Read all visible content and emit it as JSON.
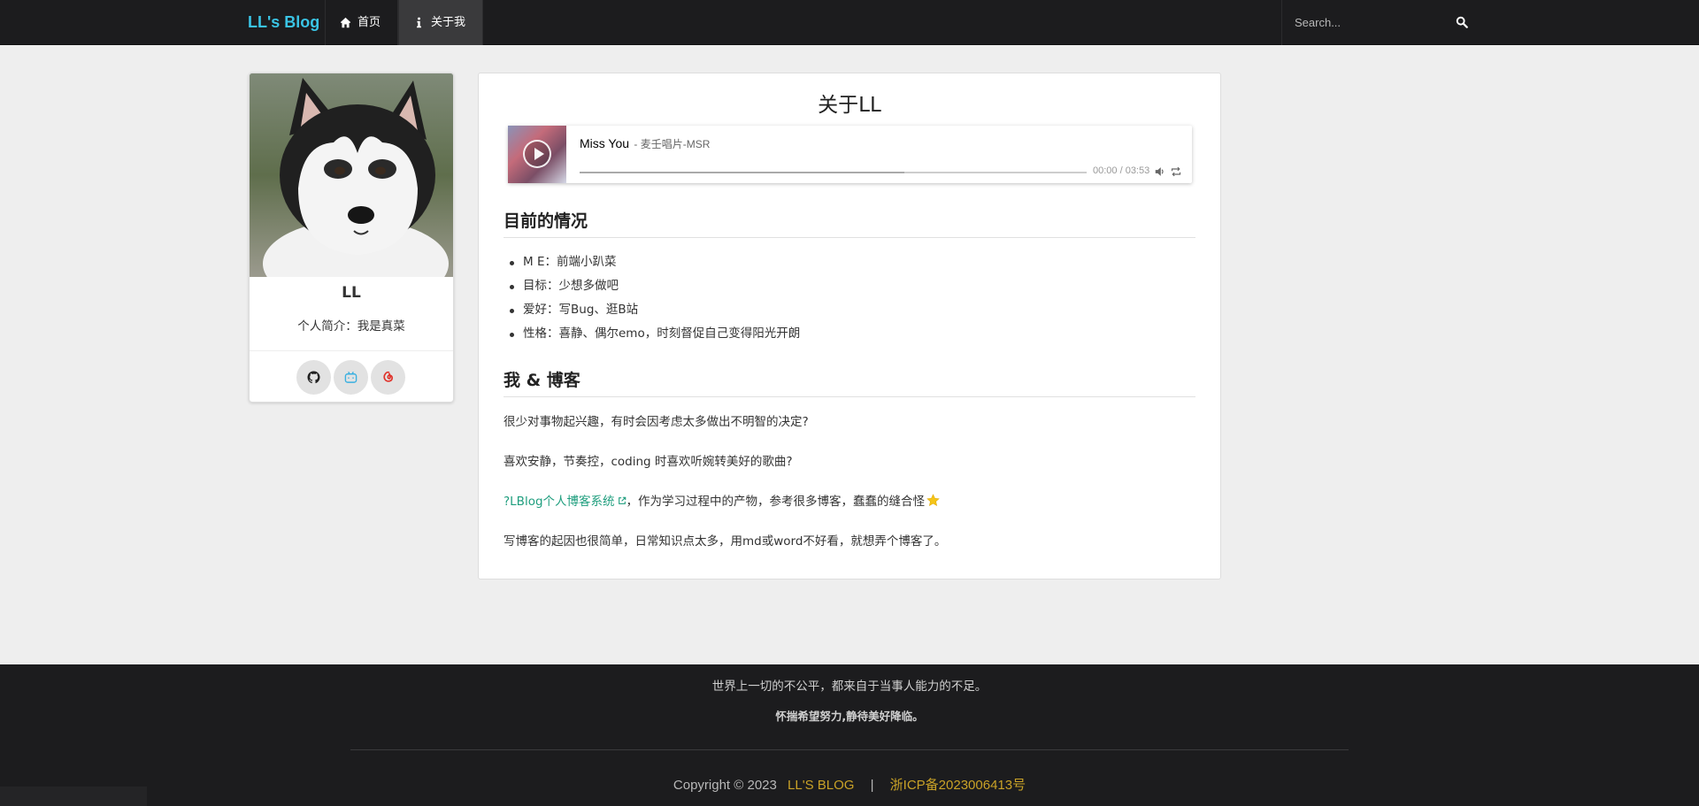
{
  "nav": {
    "brand": "LL's Blog",
    "home_label": "首页",
    "about_label": "关于我",
    "search_placeholder": "Search..."
  },
  "profile": {
    "name": "LL",
    "bio": "个人简介：我是真菜"
  },
  "article": {
    "title": "关于LL",
    "player": {
      "song": "Miss You",
      "artist": " - 麦壬唱片-MSR",
      "time": "00:00 / 03:53",
      "loaded_fraction": 0.64
    },
    "section1_title": "目前的情况",
    "status_items": [
      "M E：前端小趴菜",
      "目标：少想多做吧",
      "爱好：写Bug、逛B站",
      "性格：喜静、偶尔emo，时刻督促自己变得阳光开朗"
    ],
    "section2_title": "我 & 博客",
    "para1": "很少对事物起兴趣，有时会因考虑太多做出不明智的决定?",
    "para2": "喜欢安静，节奏控，coding 时喜欢听婉转美好的歌曲?",
    "para3_link": "?LBlog个人博客系统",
    "para3_rest": "，作为学习过程中的产物，参考很多博客，蠢蠢的缝合怪",
    "para4": "写博客的起因也很简单，日常知识点太多，用md或word不好看，就想弄个博客了。"
  },
  "footer": {
    "quote": "世界上一切的不公平，都来自于当事人能力的不足。",
    "motto": "怀揣希望努力,静待美好降临。",
    "copyright": "Copyright © 2023",
    "site": "LL'S BLOG",
    "divider": "|",
    "icp": "浙ICP备2023006413号"
  },
  "colors": {
    "brand": "#3ac4e5",
    "link": "#1f9e7e",
    "footer_gold": "#c9a227",
    "navbar_bg": "#1c1c1e"
  },
  "icons": [
    "home-icon",
    "info-icon",
    "search-icon",
    "github-icon",
    "bilibili-icon",
    "netease-music-icon",
    "play-icon",
    "volume-icon",
    "loop-icon",
    "external-link-icon",
    "star-icon"
  ]
}
